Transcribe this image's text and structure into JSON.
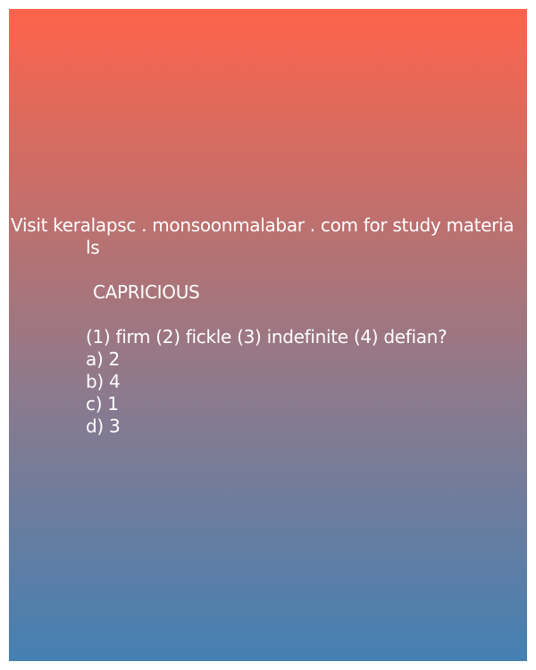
{
  "card": {
    "gradient": {
      "top": "#fe634b",
      "bottom": "#4480b3"
    },
    "text_color": "#ffffff"
  },
  "promo": {
    "line1": "Visit keralapsc . monsoonmalabar . com for study materia",
    "line2": "ls"
  },
  "question": {
    "word": "CAPRICIOUS",
    "options_line": "(1) firm (2) fickle (3) indefinite (4) defian?",
    "answers": [
      "a) 2",
      "b) 4",
      "c) 1",
      "d) 3"
    ]
  }
}
